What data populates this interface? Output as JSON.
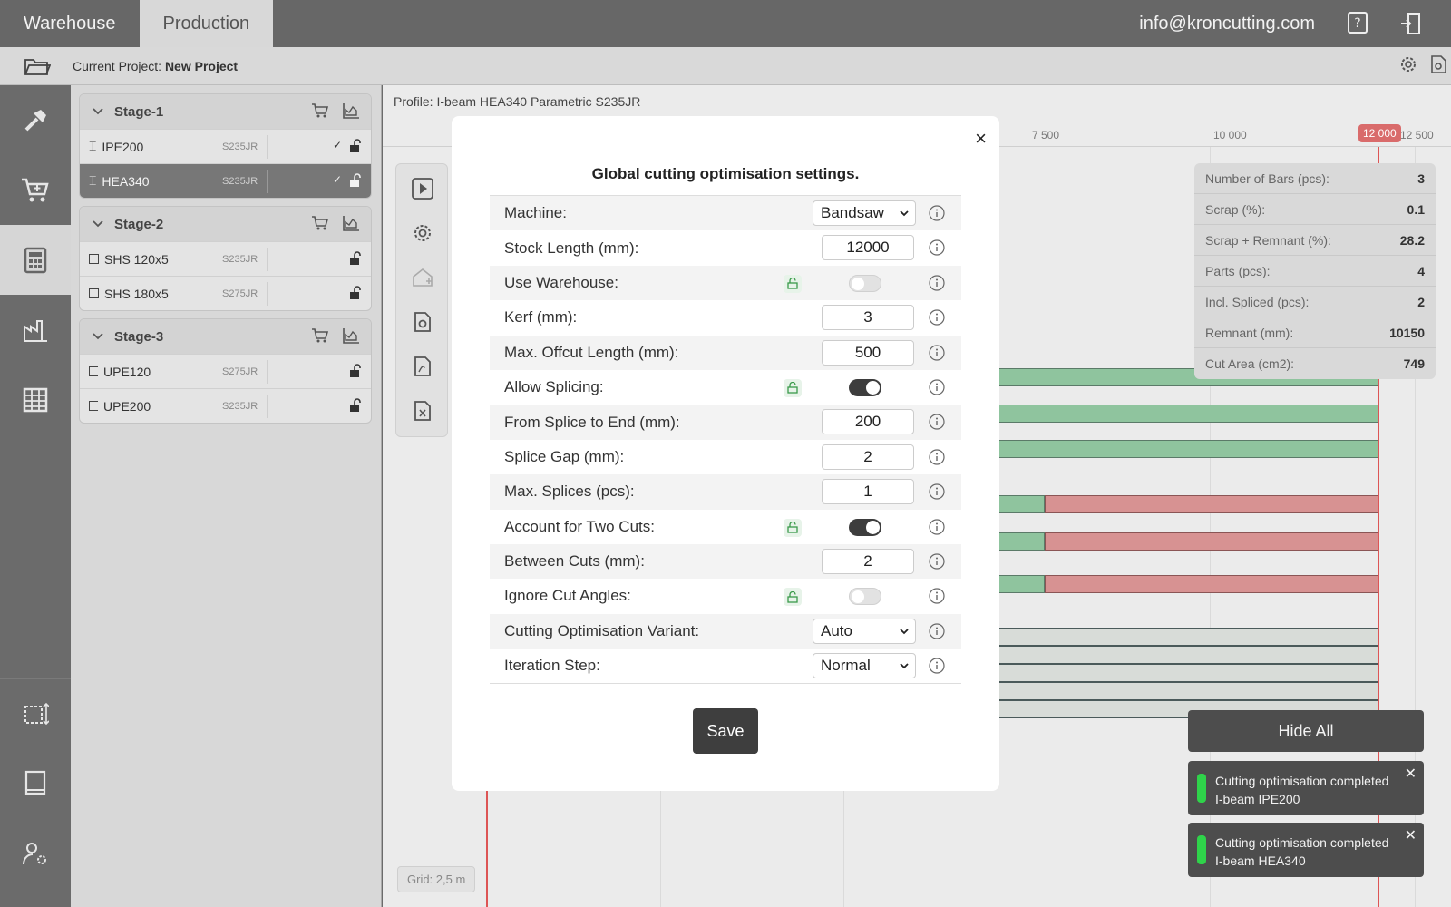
{
  "topbar": {
    "tabs": [
      {
        "label": "Warehouse"
      },
      {
        "label": "Production"
      }
    ],
    "email": "info@kroncutting.com"
  },
  "project": {
    "prefix": "Current Project:",
    "name": "New Project"
  },
  "stages": [
    {
      "title": "Stage-1",
      "items": [
        {
          "name": "IPE200",
          "grade": "S235JR"
        },
        {
          "name": "HEA340",
          "grade": "S235JR"
        }
      ]
    },
    {
      "title": "Stage-2",
      "items": [
        {
          "name": "SHS 120x5",
          "grade": "S235JR"
        },
        {
          "name": "SHS 180x5",
          "grade": "S275JR"
        }
      ]
    },
    {
      "title": "Stage-3",
      "items": [
        {
          "name": "UPE120",
          "grade": "S275JR"
        },
        {
          "name": "UPE200",
          "grade": "S235JR"
        }
      ]
    }
  ],
  "main": {
    "profile": "Profile: I-beam HEA340 Parametric S235JR",
    "ruler": [
      "7 500",
      "10 000",
      "12 000",
      "12 500"
    ],
    "grid_label": "Grid: 2,5 m"
  },
  "stats": [
    {
      "label": "Number of Bars (pcs):",
      "value": "3"
    },
    {
      "label": "Scrap (%):",
      "value": "0.1"
    },
    {
      "label": "Scrap + Remnant (%):",
      "value": "28.2"
    },
    {
      "label": "Parts (pcs):",
      "value": "4"
    },
    {
      "label": "Incl. Spliced (pcs):",
      "value": "2"
    },
    {
      "label": "Remnant (mm):",
      "value": "10150"
    },
    {
      "label": "Cut Area (cm2):",
      "value": "749"
    }
  ],
  "toasts": {
    "hide_all": "Hide All",
    "items": [
      {
        "line1": "Cutting optimisation completed",
        "line2": "I-beam IPE200"
      },
      {
        "line1": "Cutting optimisation completed",
        "line2": "I-beam HEA340"
      }
    ]
  },
  "modal": {
    "title": "Global cutting optimisation settings.",
    "close": "×",
    "save": "Save",
    "rows": [
      {
        "label": "Machine:",
        "select": "Bandsaw"
      },
      {
        "label": "Stock Length (mm):",
        "value": "12000"
      },
      {
        "label": "Use Warehouse:",
        "toggle": false
      },
      {
        "label": "Kerf (mm):",
        "value": "3"
      },
      {
        "label": "Max. Offcut Length (mm):",
        "value": "500"
      },
      {
        "label": "Allow Splicing:",
        "toggle": true
      },
      {
        "label": "From Splice to End (mm):",
        "value": "200"
      },
      {
        "label": "Splice Gap (mm):",
        "value": "2"
      },
      {
        "label": "Max. Splices (pcs):",
        "value": "1"
      },
      {
        "label": "Account for Two Cuts:",
        "toggle": true
      },
      {
        "label": "Between Cuts (mm):",
        "value": "2"
      },
      {
        "label": "Ignore Cut Angles:",
        "toggle": false
      },
      {
        "label": "Cutting Optimisation Variant:",
        "select": "Auto"
      },
      {
        "label": "Iteration Step:",
        "select": "Normal"
      }
    ]
  }
}
